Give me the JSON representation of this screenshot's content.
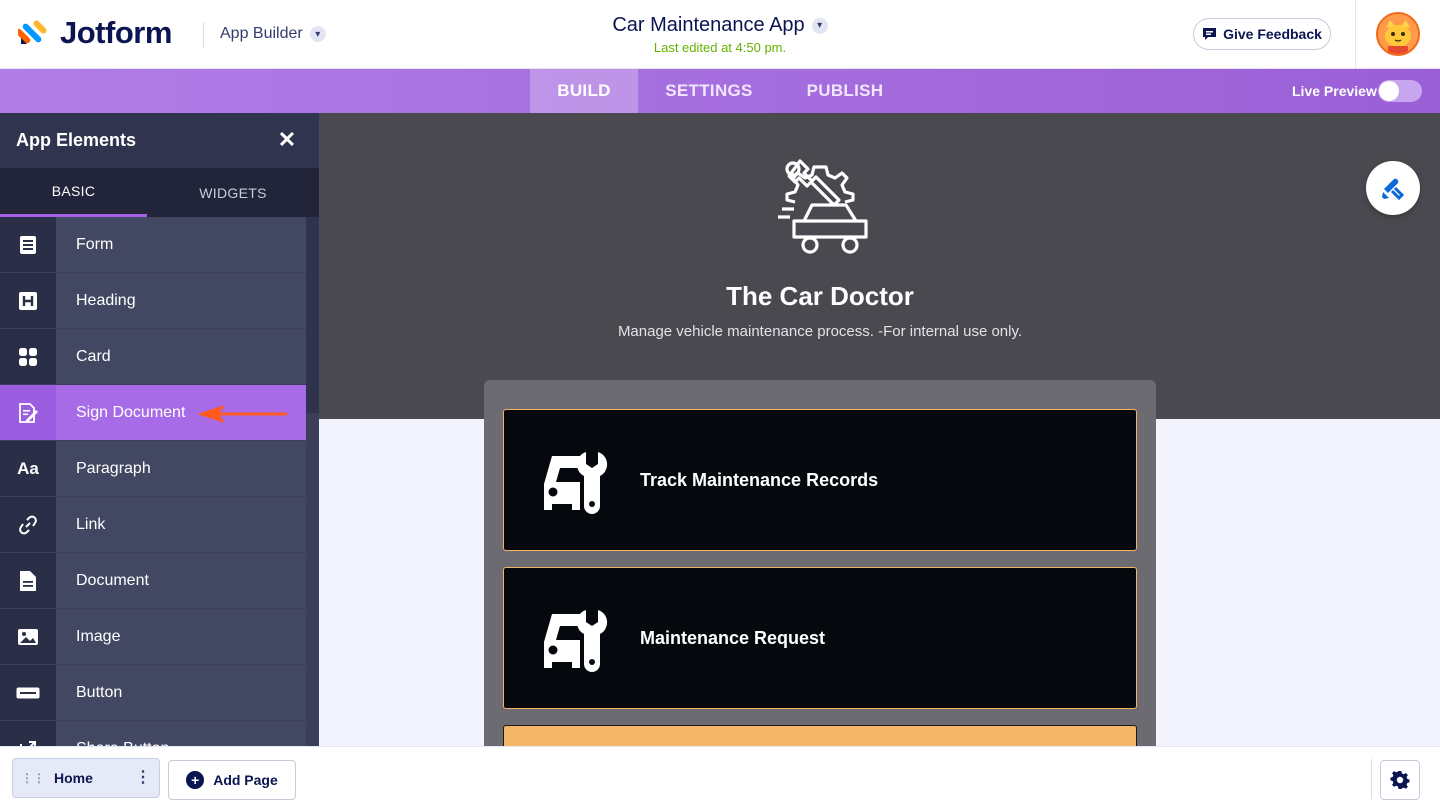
{
  "header": {
    "brand": "Jotform",
    "product": "App Builder",
    "app_title": "Car Maintenance App",
    "last_edited": "Last edited at 4:50 pm.",
    "feedback_label": "Give Feedback"
  },
  "nav": {
    "tabs": [
      {
        "label": "BUILD",
        "active": true
      },
      {
        "label": "SETTINGS",
        "active": false
      },
      {
        "label": "PUBLISH",
        "active": false
      }
    ],
    "live_preview_label": "Live Preview",
    "live_preview_on": false
  },
  "sidebar": {
    "title": "App Elements",
    "tabs": [
      {
        "label": "BASIC",
        "active": true
      },
      {
        "label": "WIDGETS",
        "active": false
      }
    ],
    "items": [
      {
        "label": "Form",
        "icon": "form-icon"
      },
      {
        "label": "Heading",
        "icon": "heading-icon"
      },
      {
        "label": "Card",
        "icon": "card-icon"
      },
      {
        "label": "Sign Document",
        "icon": "sign-document-icon",
        "active": true
      },
      {
        "label": "Paragraph",
        "icon": "paragraph-icon"
      },
      {
        "label": "Link",
        "icon": "link-icon"
      },
      {
        "label": "Document",
        "icon": "document-icon"
      },
      {
        "label": "Image",
        "icon": "image-icon"
      },
      {
        "label": "Button",
        "icon": "button-icon"
      },
      {
        "label": "Share Button",
        "icon": "share-icon"
      }
    ]
  },
  "canvas": {
    "app_name": "The Car Doctor",
    "description": "Manage vehicle maintenance process. -For internal use only.",
    "cards": [
      {
        "label": "Track Maintenance Records",
        "icon": "car-wrench-icon"
      },
      {
        "label": "Maintenance Request",
        "icon": "car-wrench-icon"
      }
    ],
    "colors": {
      "hero_bg": "#4a494f",
      "card_bg": "#05080c",
      "card_border": "#f5b368",
      "accent": "#a86be8"
    }
  },
  "bottom": {
    "pages": [
      {
        "label": "Home"
      }
    ],
    "add_page_label": "Add Page"
  }
}
